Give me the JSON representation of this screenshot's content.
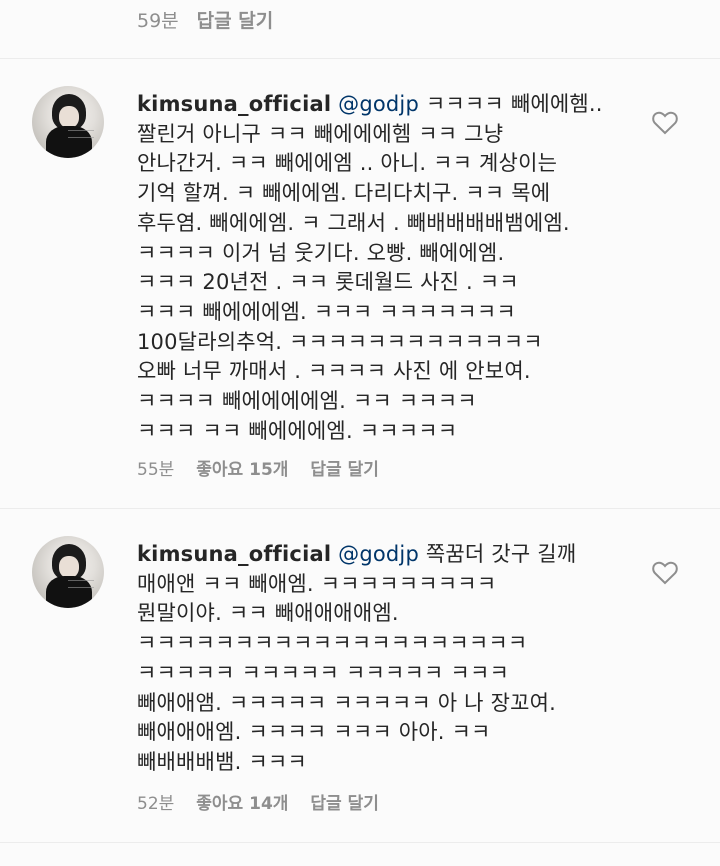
{
  "top": {
    "time": "59분",
    "reply": "답글 달기"
  },
  "comments": [
    {
      "username": "kimsuna_official",
      "mention": "@godjp",
      "text": " ㅋㅋㅋㅋ 빼에에헴..\n짤린거 아니구 ㅋㅋ 빼에에에헴 ㅋㅋ 그냥\n안나간거. ㅋㅋ 빼에에엠 .. 아니. ㅋㅋ 계상이는\n기억 할껴. ㅋ 빼에에엠. 다리다치구. ㅋㅋ 목에\n후두염. 빼에에엠. ㅋ 그래서 . 빼배배배배뱀에엠.\nㅋㅋㅋㅋ 이거 넘 웃기다. 오빵. 빼에에엠.\nㅋㅋㅋ 20년전 . ㅋㅋ 롯데월드 사진 . ㅋㅋ\nㅋㅋㅋ 빼에에에엠. ㅋㅋㅋ ㅋㅋㅋㅋㅋㅋㅋ\n100달라의추억. ㅋㅋㅋㅋㅋㅋㅋㅋㅋㅋㅋㅋㅋ\n오빠 너무 까매서 . ㅋㅋㅋㅋ 사진 에 안보여.\nㅋㅋㅋㅋ 빼에에에에엠. ㅋㅋ ㅋㅋㅋㅋ\nㅋㅋㅋ ㅋㅋ 빼에에에엠. ㅋㅋㅋㅋㅋ",
      "time": "55분",
      "likes": "좋아요 15개",
      "reply": "답글 달기"
    },
    {
      "username": "kimsuna_official",
      "mention": "@godjp",
      "text": " 쪽꿈더 갓구 길깨\n매애앤 ㅋㅋ 빼애엠. ㅋㅋㅋㅋㅋㅋㅋㅋㅋ\n뭔말이야. ㅋㅋ 빼애애애애엠.\nㅋㅋㅋㅋㅋㅋㅋㅋㅋㅋㅋㅋㅋㅋㅋㅋㅋㅋㅋㅋ\nㅋㅋㅋㅋㅋ ㅋㅋㅋㅋㅋ ㅋㅋㅋㅋㅋ ㅋㅋㅋ\n빼애애앰. ㅋㅋㅋㅋㅋ ㅋㅋㅋㅋㅋ 아 나 장꼬여.\n빼애애애엠. ㅋㅋㅋㅋ ㅋㅋㅋ 아아. ㅋㅋ\n빼배배배뱀. ㅋㅋㅋ",
      "time": "52분",
      "likes": "좋아요 14개",
      "reply": "답글 달기"
    }
  ]
}
